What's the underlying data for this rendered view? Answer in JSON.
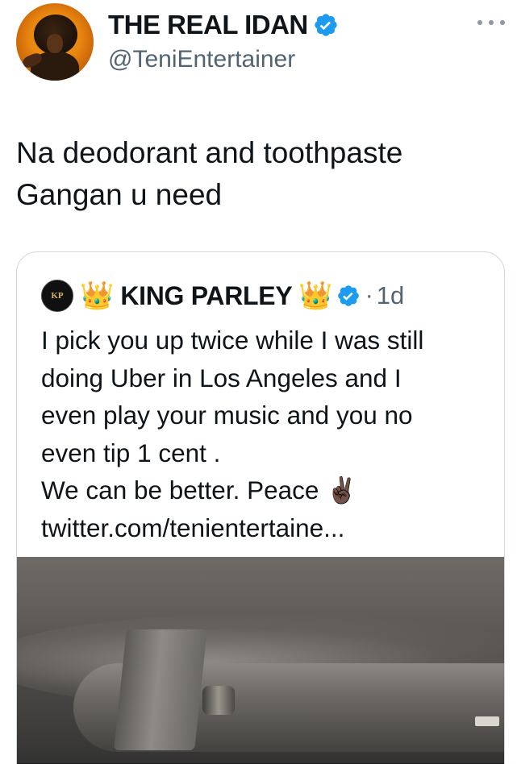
{
  "tweet": {
    "author_name": "THE REAL IDAN",
    "author_handle": "@TeniEntertainer",
    "verified": true,
    "text_lines": [
      "Na deodorant and toothpaste",
      "Gangan u need"
    ]
  },
  "quoted_tweet": {
    "avatar_initials": "KP",
    "name": "KING PARLEY",
    "name_prefix_emoji": "👑",
    "name_suffix_emoji": "👑",
    "verified": true,
    "separator": "·",
    "time": "1d",
    "text_lines": [
      "I pick you up twice while I was still",
      "doing Uber in Los Angeles and I",
      "even play your music and you no",
      "even tip 1 cent .",
      "We can be better. Peace ✌🏿",
      "twitter.com/tenientertaine..."
    ],
    "media_icon": "car-sun-visor-photo"
  },
  "colors": {
    "verified_blue": "#1d9bf0",
    "secondary_text": "#536471",
    "border": "#cfd9de"
  },
  "icons": {
    "more": "more-horizontal-icon",
    "verified": "verified-badge-icon"
  }
}
